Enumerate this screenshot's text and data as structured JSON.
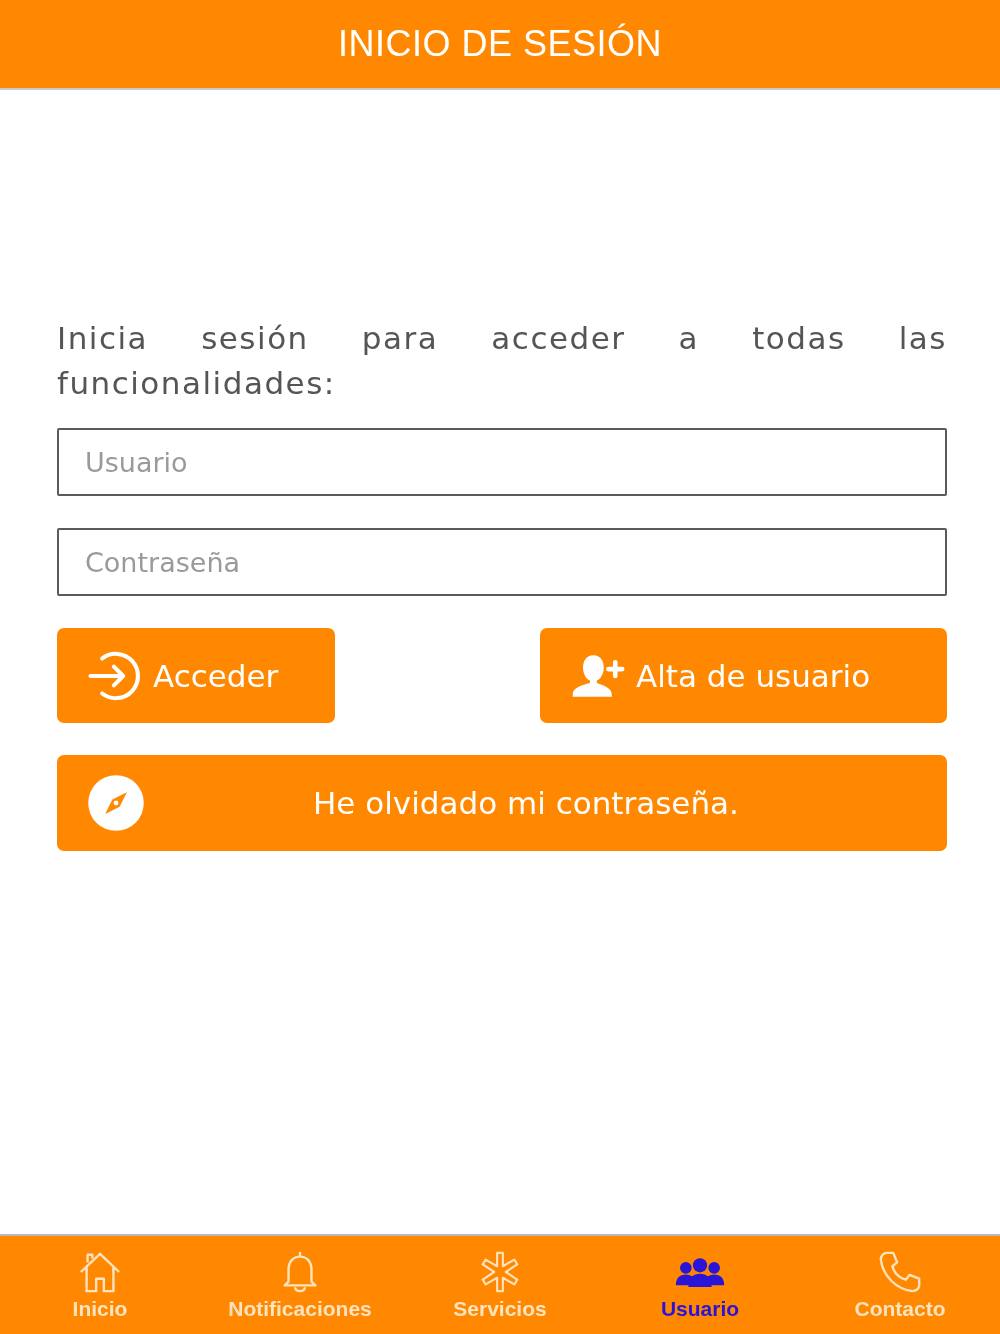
{
  "header": {
    "title": "INICIO DE SESIÓN"
  },
  "intro": "Inicia sesión para acceder a todas las funcionalidades:",
  "fields": [
    {
      "placeholder": "Usuario"
    },
    {
      "placeholder": "Contraseña"
    }
  ],
  "buttons": [
    {
      "label": "Acceder",
      "kind": "login"
    },
    {
      "label": "Alta de usuario",
      "kind": "signup"
    }
  ],
  "forgot_button": {
    "label": "He olvidado mi contraseña."
  },
  "nav": [
    {
      "label": "Inicio",
      "kind": "home",
      "selected": false
    },
    {
      "label": "Notificaciones",
      "kind": "bell",
      "selected": false
    },
    {
      "label": "Servicios",
      "kind": "services",
      "selected": false
    },
    {
      "label": "Usuario",
      "kind": "users",
      "selected": true
    },
    {
      "label": "Contacto",
      "kind": "phone",
      "selected": false
    }
  ]
}
